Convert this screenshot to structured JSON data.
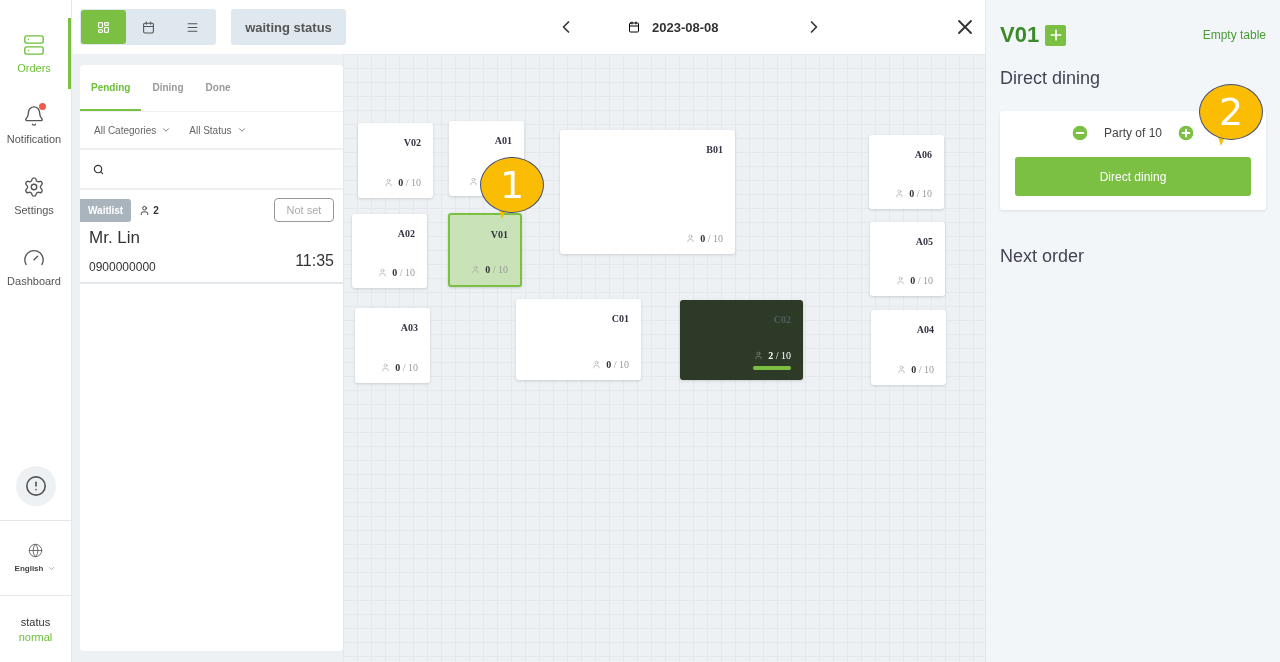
{
  "sidebar": {
    "items": [
      {
        "kind": "orders",
        "label": "Orders",
        "selected": true,
        "dot": false
      },
      {
        "kind": "notification",
        "label": "Notification",
        "selected": false,
        "dot": true
      },
      {
        "kind": "settings",
        "label": "Settings",
        "selected": false,
        "dot": false
      },
      {
        "kind": "dashboard",
        "label": "Dashboard",
        "selected": false,
        "dot": false
      }
    ],
    "language": "English",
    "status": {
      "label": "status",
      "value": "normal"
    }
  },
  "toolbar": {
    "view_modes": [
      {
        "kind": "grid",
        "selected": true
      },
      {
        "kind": "calendar",
        "selected": false
      },
      {
        "kind": "list",
        "selected": false
      }
    ],
    "waiting_button": "waiting status",
    "date": "2023-08-08"
  },
  "orders_panel": {
    "tabs": [
      {
        "label": "Pending",
        "selected": true
      },
      {
        "label": "Dining",
        "selected": false
      },
      {
        "label": "Done",
        "selected": false
      }
    ],
    "filters": [
      "All Categories",
      "All Status"
    ],
    "orders": [
      {
        "tag": "Waitlist",
        "party": "2",
        "seat": "Not set",
        "name": "Mr. Lin",
        "phone": "0900000000",
        "time": "11:35"
      }
    ]
  },
  "floor": {
    "tables": [
      {
        "name": "V02",
        "count": "**0** / 10",
        "selected": false,
        "occupied": false
      },
      {
        "name": "A01",
        "selected": false,
        "occupied": false
      },
      {
        "name": "B01",
        "count": "**0** / 10",
        "selected": false,
        "occupied": false
      },
      {
        "name": "A02",
        "count": "**0** / 10",
        "selected": false,
        "occupied": false
      },
      {
        "name": "V01",
        "count": "**0** / 10",
        "selected": true,
        "occupied": false
      },
      {
        "name": "A03",
        "count": "**0** / 10",
        "selected": false,
        "occupied": false
      },
      {
        "name": "C01",
        "count": "**0** / 10",
        "selected": false,
        "occupied": false
      },
      {
        "name": "C02",
        "count": "**2** / 10",
        "selected": false,
        "occupied": true,
        "level": 1
      },
      {
        "name": "A06",
        "count": "**0** / 10",
        "selected": false,
        "occupied": false
      },
      {
        "name": "A05",
        "count": "**0** / 10",
        "selected": false,
        "occupied": false
      },
      {
        "name": "A04",
        "count": "**0** / 10",
        "selected": false,
        "occupied": false
      }
    ],
    "callout": "1"
  },
  "detail": {
    "table": "V01",
    "state": "Empty table",
    "section": "Direct dining",
    "party": "Party of 10",
    "button": "Direct dining",
    "next": "Next order",
    "callout": "2"
  }
}
